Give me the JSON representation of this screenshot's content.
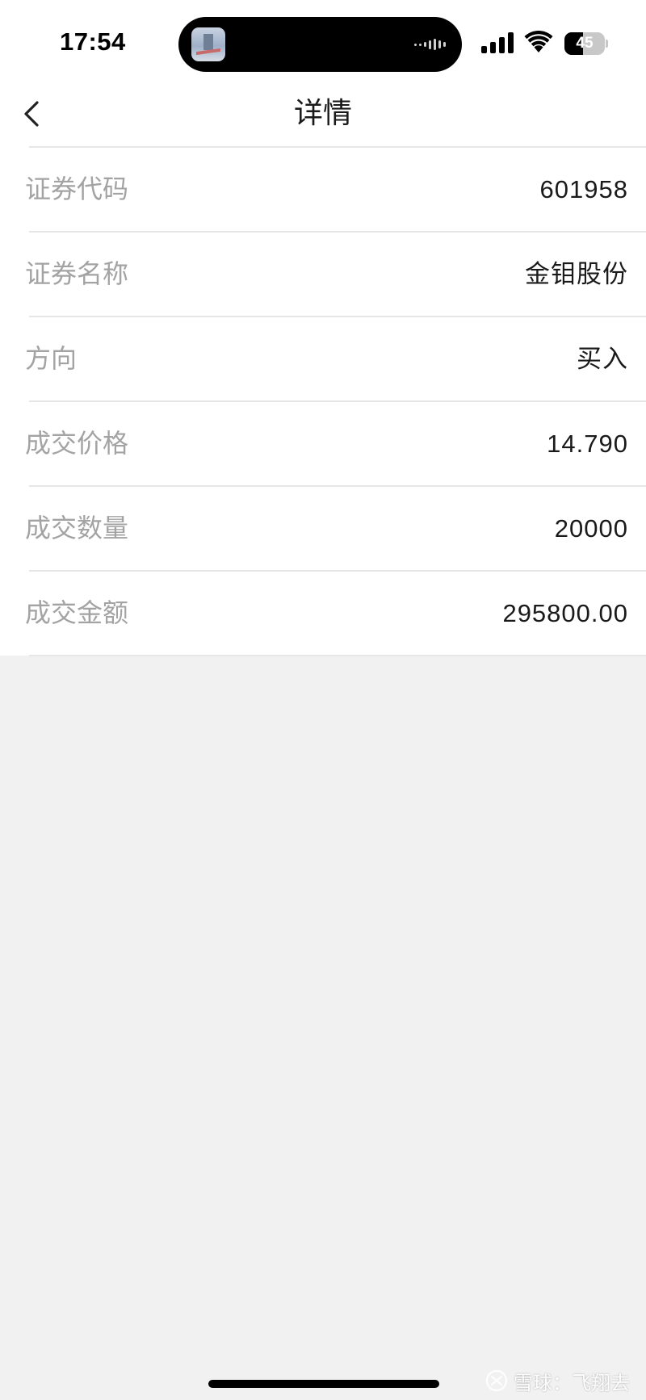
{
  "status_bar": {
    "time": "17:54",
    "battery_level": "45",
    "battery_fraction": 0.45,
    "icons": [
      "signal-icon",
      "wifi-icon",
      "battery-icon"
    ]
  },
  "nav": {
    "title": "详情",
    "back_icon": "chevron-left-icon"
  },
  "details": [
    {
      "label": "证券代码",
      "value": "601958"
    },
    {
      "label": "证券名称",
      "value": "金钼股份"
    },
    {
      "label": "方向",
      "value": "买入"
    },
    {
      "label": "成交价格",
      "value": "14.790"
    },
    {
      "label": "成交数量",
      "value": "20000"
    },
    {
      "label": "成交金额",
      "value": "295800.00"
    }
  ],
  "watermark": {
    "text": "雪球：飞翔去",
    "icon": "snowball-logo-icon"
  },
  "colors": {
    "background": "#f1f1f1",
    "card": "#ffffff",
    "label": "#a3a3a3",
    "value": "#1a1a1a",
    "divider": "#e6e6e6"
  }
}
